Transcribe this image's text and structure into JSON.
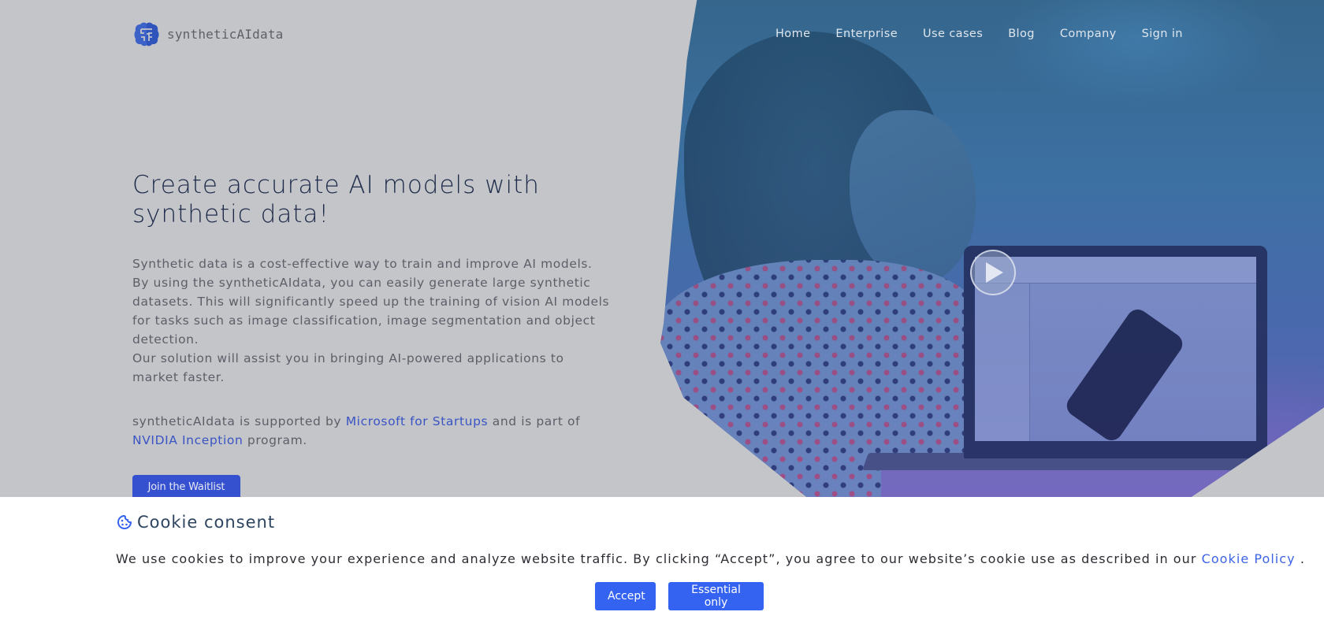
{
  "header": {
    "logo_text": "syntheticAIdata",
    "logo_icon": "brain-icon",
    "nav": [
      {
        "label": "Home"
      },
      {
        "label": "Enterprise"
      },
      {
        "label": "Use cases"
      },
      {
        "label": "Blog"
      },
      {
        "label": "Company"
      },
      {
        "label": "Sign in"
      }
    ]
  },
  "hero": {
    "title": "Create accurate AI models with synthetic data!",
    "description_lines": [
      "Synthetic data is a cost-effective way to train and improve AI models.",
      "By using the syntheticAIdata, you can easily generate large synthetic",
      "datasets. This will significantly speed up the training of vision AI models",
      "for tasks such as image classification, image segmentation and object",
      "detection.",
      "Our solution will assist you in bringing AI-powered applications to",
      "market faster."
    ],
    "support": {
      "prefix": "syntheticAIdata is supported by ",
      "link1": "Microsoft for Startups",
      "middle": " and is part of",
      "link2": "NVIDIA Inception",
      "suffix": " program."
    },
    "cta_label": "Join the Waitlist",
    "video_icon": "play-icon"
  },
  "cookie": {
    "icon": "cookie-icon",
    "title": "Cookie consent",
    "text": "We use cookies to improve your experience and analyze website traffic. By clicking “Accept”, you agree to our website’s cookie use as described in our ",
    "link": "Cookie Policy",
    "text_end": " .",
    "accept_label": "Accept",
    "essential_label": "Essential only"
  },
  "colors": {
    "page_bg": "#c4c5c9",
    "brand_blue": "#3651cf",
    "link_blue": "#3a54c4",
    "cookie_button": "#3563f1",
    "title_dark": "#1d2a4a"
  }
}
